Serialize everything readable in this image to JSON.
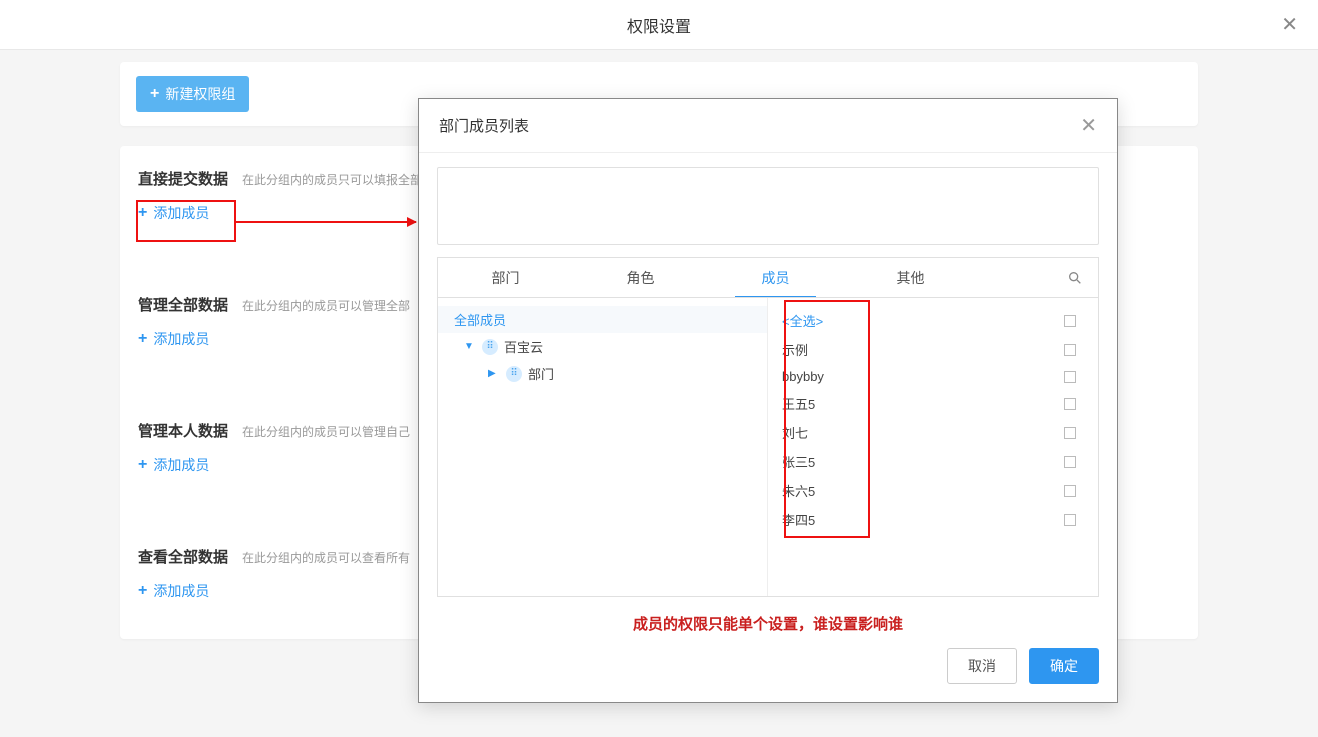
{
  "header": {
    "title": "权限设置"
  },
  "toolbar": {
    "new_group_label": "新建权限组"
  },
  "groups": [
    {
      "title": "直接提交数据",
      "desc": "在此分组内的成员只可以填报全部",
      "add_label": "添加成员"
    },
    {
      "title": "管理全部数据",
      "desc": "在此分组内的成员可以管理全部",
      "add_label": "添加成员"
    },
    {
      "title": "管理本人数据",
      "desc": "在此分组内的成员可以管理自己",
      "add_label": "添加成员"
    },
    {
      "title": "查看全部数据",
      "desc": "在此分组内的成员可以查看所有",
      "add_label": "添加成员"
    }
  ],
  "modal": {
    "title": "部门成员列表",
    "tabs": {
      "dept": "部门",
      "role": "角色",
      "member": "成员",
      "other": "其他"
    },
    "tree": {
      "root": "全部成员",
      "org": "百宝云",
      "dept": "部门"
    },
    "select_all": "<全选>",
    "members": [
      "示例",
      "bbybby",
      "王五5",
      "刘七",
      "张三5",
      "朱六5",
      "李四5"
    ],
    "note": "成员的权限只能单个设置，谁设置影响谁",
    "cancel": "取消",
    "confirm": "确定"
  }
}
